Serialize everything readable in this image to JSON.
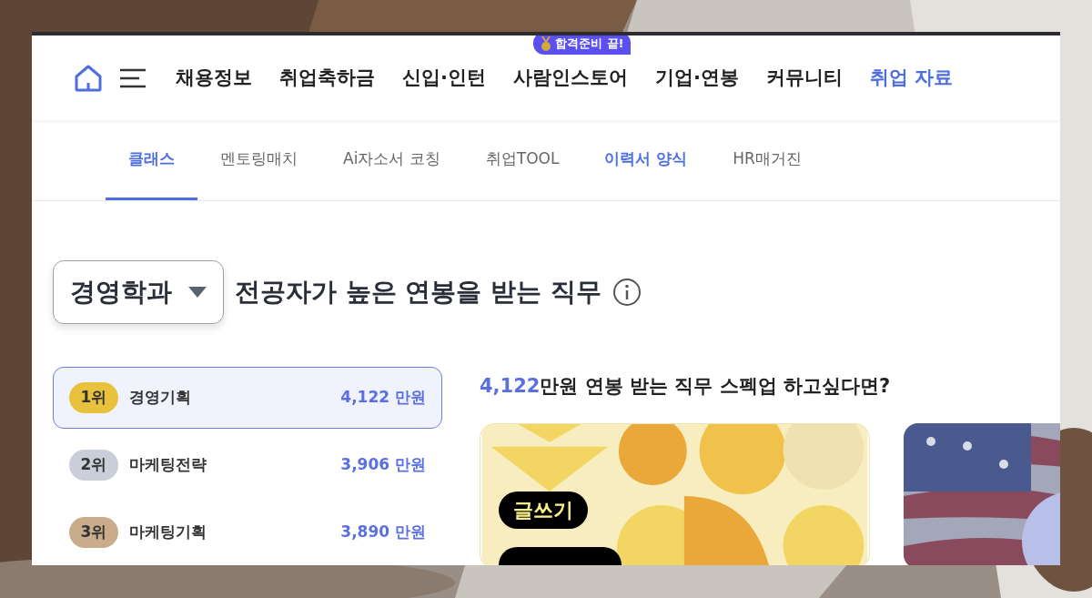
{
  "nav": {
    "items": [
      {
        "label": "채용정보",
        "highlight": false
      },
      {
        "label": "취업축하금",
        "highlight": false
      },
      {
        "label": "신입·인턴",
        "highlight": false
      },
      {
        "label": "사람인스토어",
        "highlight": false,
        "badge": "합격준비 끝!"
      },
      {
        "label": "기업·연봉",
        "highlight": false
      },
      {
        "label": "커뮤니티",
        "highlight": false
      },
      {
        "label": "취업 자료",
        "highlight": true
      }
    ]
  },
  "subtabs": [
    {
      "label": "클래스",
      "selected": true
    },
    {
      "label": "멘토링매치",
      "selected": false,
      "highlight": false
    },
    {
      "label": "Ai자소서 코칭",
      "selected": false,
      "highlight": false
    },
    {
      "label": "취업TOOL",
      "selected": false,
      "highlight": false
    },
    {
      "label": "이력서 양식",
      "selected": false,
      "highlight": true
    },
    {
      "label": "HR매거진",
      "selected": false,
      "highlight": false
    }
  ],
  "major_select": {
    "value": "경영학과"
  },
  "title": "전공자가 높은 연봉을 받는 직무",
  "ranking": [
    {
      "rank": "1위",
      "job": "경영기획",
      "salary": "4,122 만원",
      "selected": true,
      "color": "#e8c23c"
    },
    {
      "rank": "2위",
      "job": "마케팅전략",
      "salary": "3,906 만원",
      "selected": false,
      "color": "#c9ced8"
    },
    {
      "rank": "3위",
      "job": "마케팅기획",
      "salary": "3,890 만원",
      "selected": false,
      "color": "#c8ac8c"
    }
  ],
  "promo": {
    "amount": "4,122",
    "text": "만원 연봉 받는 직무 스펙업 하고싶다면?",
    "cards": [
      {
        "kind": "illustration",
        "tag": "글쓰기"
      },
      {
        "kind": "picture"
      }
    ]
  }
}
